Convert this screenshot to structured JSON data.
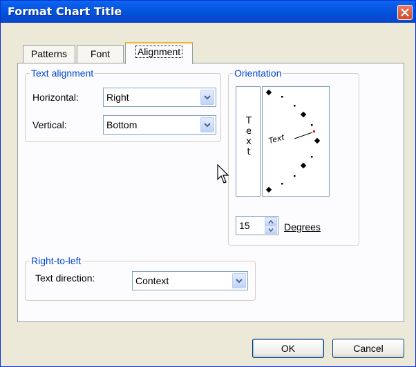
{
  "window": {
    "title": "Format Chart Title"
  },
  "tabs": [
    {
      "label": "Patterns"
    },
    {
      "label": "Font"
    },
    {
      "label": "Alignment"
    }
  ],
  "text_alignment": {
    "legend": "Text alignment",
    "horizontal_label": "Horizontal:",
    "horizontal_value": "Right",
    "vertical_label": "Vertical:",
    "vertical_value": "Bottom"
  },
  "orientation": {
    "legend": "Orientation",
    "vertical_text": [
      "T",
      "e",
      "x",
      "t"
    ],
    "dial_text": "Text",
    "degrees_value": "15",
    "degrees_label": "Degrees"
  },
  "rtl": {
    "legend": "Right-to-left",
    "direction_label": "Text direction:",
    "direction_value": "Context"
  },
  "buttons": {
    "ok": "OK",
    "cancel": "Cancel"
  },
  "icons": {
    "close": "close-icon",
    "dropdown": "chevron-down-icon",
    "spin_up": "spin-up-icon",
    "spin_down": "spin-down-icon",
    "cursor": "mouse-pointer-icon"
  },
  "colors": {
    "titlebar": "#0a5ee9",
    "legend_text": "#0046d5",
    "tab_highlight": "#f4b433",
    "dialog_bg": "#ece9d8"
  }
}
